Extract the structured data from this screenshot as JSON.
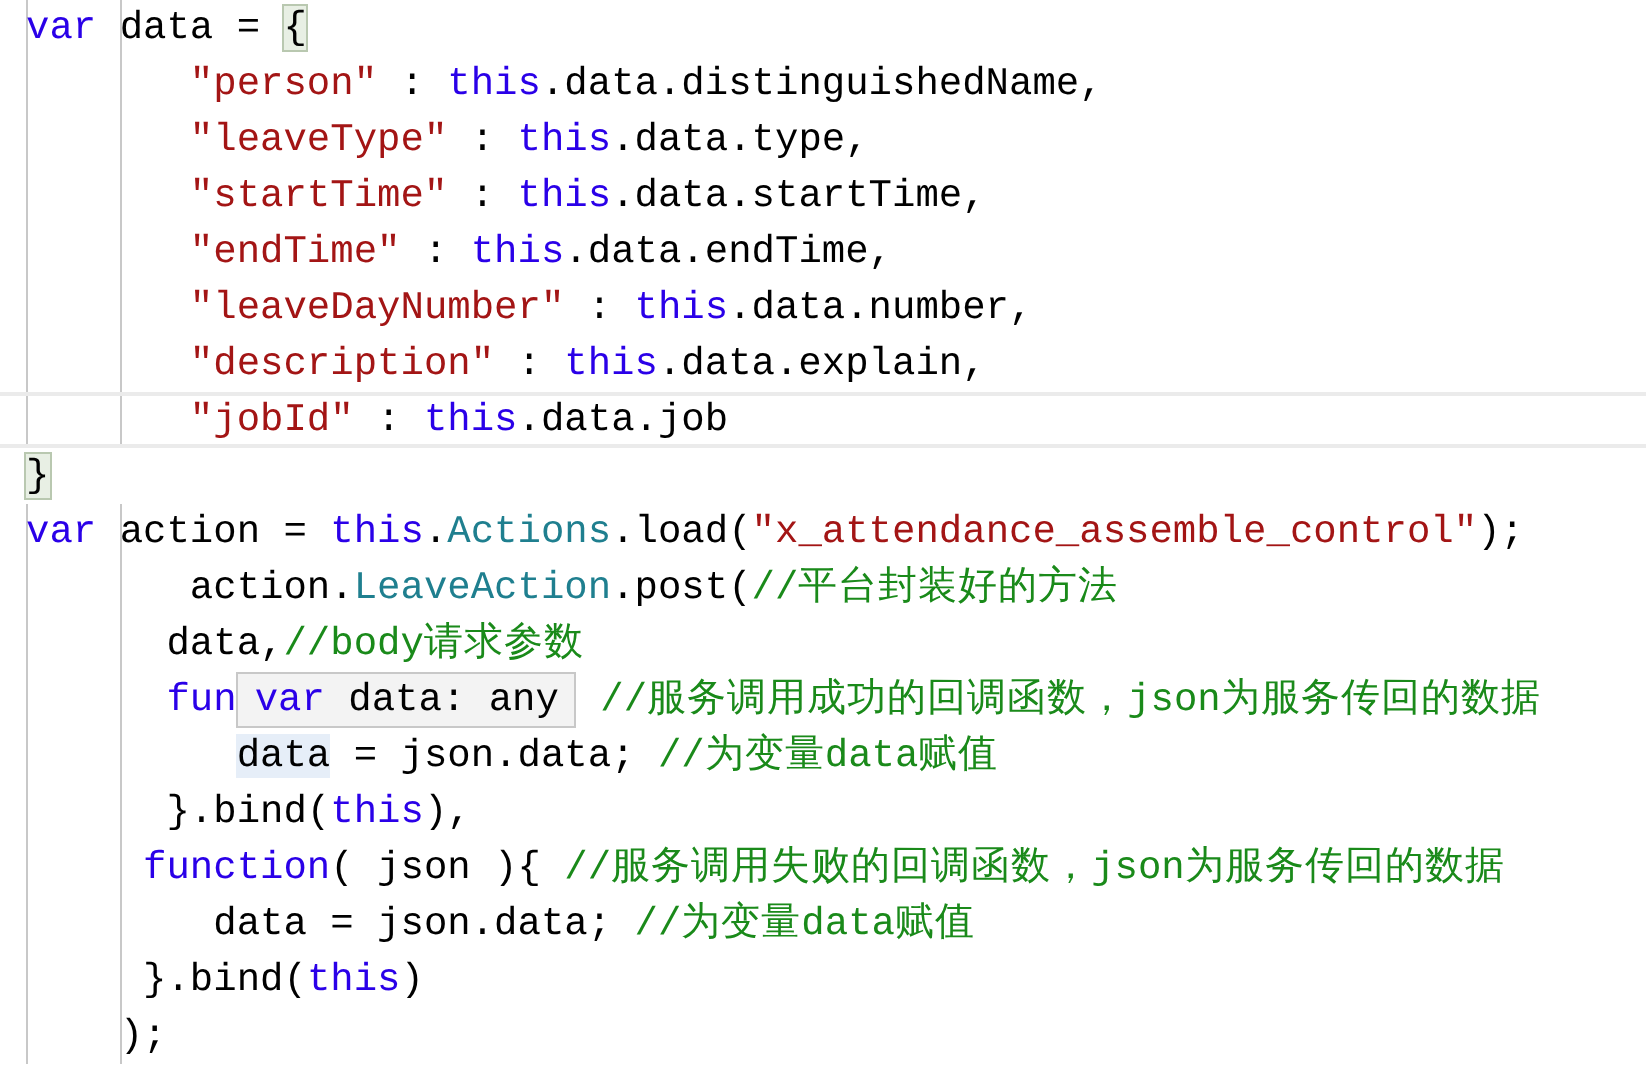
{
  "editor": {
    "lines": [
      {
        "current": false,
        "tokens": [
          {
            "kind": "kw",
            "text": "var"
          },
          {
            "kind": "plain",
            "text": " data = "
          },
          {
            "kind": "plain",
            "text": "{",
            "matched": true
          }
        ]
      },
      {
        "current": false,
        "tokens": [
          {
            "kind": "str",
            "text": "       \"person\""
          },
          {
            "kind": "plain",
            "text": " : "
          },
          {
            "kind": "kw",
            "text": "this"
          },
          {
            "kind": "plain",
            "text": ".data.distinguishedName,"
          }
        ]
      },
      {
        "current": false,
        "tokens": [
          {
            "kind": "str",
            "text": "       \"leaveType\""
          },
          {
            "kind": "plain",
            "text": " : "
          },
          {
            "kind": "kw",
            "text": "this"
          },
          {
            "kind": "plain",
            "text": ".data.type,"
          }
        ]
      },
      {
        "current": false,
        "tokens": [
          {
            "kind": "str",
            "text": "       \"startTime\""
          },
          {
            "kind": "plain",
            "text": " : "
          },
          {
            "kind": "kw",
            "text": "this"
          },
          {
            "kind": "plain",
            "text": ".data.startTime,"
          }
        ]
      },
      {
        "current": false,
        "tokens": [
          {
            "kind": "str",
            "text": "       \"endTime\""
          },
          {
            "kind": "plain",
            "text": " : "
          },
          {
            "kind": "kw",
            "text": "this"
          },
          {
            "kind": "plain",
            "text": ".data.endTime,"
          }
        ]
      },
      {
        "current": false,
        "tokens": [
          {
            "kind": "str",
            "text": "       \"leaveDayNumber\""
          },
          {
            "kind": "plain",
            "text": " : "
          },
          {
            "kind": "kw",
            "text": "this"
          },
          {
            "kind": "plain",
            "text": ".data.number,"
          }
        ]
      },
      {
        "current": false,
        "tokens": [
          {
            "kind": "str",
            "text": "       \"description\""
          },
          {
            "kind": "plain",
            "text": " : "
          },
          {
            "kind": "kw",
            "text": "this"
          },
          {
            "kind": "plain",
            "text": ".data.explain,"
          }
        ]
      },
      {
        "current": true,
        "tokens": [
          {
            "kind": "str",
            "text": "       \"jobId\""
          },
          {
            "kind": "plain",
            "text": " : "
          },
          {
            "kind": "kw",
            "text": "this"
          },
          {
            "kind": "plain",
            "text": ".data.job"
          }
        ]
      },
      {
        "current": false,
        "tokens": [
          {
            "kind": "plain",
            "text": "}",
            "matched": true
          }
        ]
      },
      {
        "current": false,
        "tokens": [
          {
            "kind": "kw",
            "text": "var"
          },
          {
            "kind": "plain",
            "text": " action = "
          },
          {
            "kind": "kw",
            "text": "this"
          },
          {
            "kind": "plain",
            "text": "."
          },
          {
            "kind": "type",
            "text": "Actions"
          },
          {
            "kind": "plain",
            "text": ".load("
          },
          {
            "kind": "str",
            "text": "\"x_attendance_assemble_control\""
          },
          {
            "kind": "plain",
            "text": ");"
          }
        ]
      },
      {
        "current": false,
        "tokens": [
          {
            "kind": "plain",
            "text": "       action."
          },
          {
            "kind": "type",
            "text": "LeaveAction"
          },
          {
            "kind": "plain",
            "text": ".post("
          },
          {
            "kind": "com",
            "text": "//平台封装好的方法"
          }
        ]
      },
      {
        "current": false,
        "tokens": [
          {
            "kind": "plain",
            "text": "      data,"
          },
          {
            "kind": "com",
            "text": "//body请求参数"
          }
        ]
      },
      {
        "current": false,
        "tokens": [
          {
            "kind": "kw",
            "text": "      fun"
          },
          {
            "kind": "tooltip",
            "tokens": [
              {
                "kind": "kw",
                "text": "var"
              },
              {
                "kind": "plain",
                "text": " data: any"
              }
            ]
          },
          {
            "kind": "com",
            "text": " //服务调用成功的回调函数，json为服务传回的数据"
          }
        ]
      },
      {
        "current": false,
        "tokens": [
          {
            "kind": "plain",
            "text": "         data",
            "highlighted": true
          },
          {
            "kind": "plain",
            "text": " = json.data; "
          },
          {
            "kind": "com",
            "text": "//为变量data赋值"
          }
        ]
      },
      {
        "current": false,
        "tokens": [
          {
            "kind": "plain",
            "text": "      }.bind("
          },
          {
            "kind": "kw",
            "text": "this"
          },
          {
            "kind": "plain",
            "text": "),"
          }
        ]
      },
      {
        "current": false,
        "tokens": [
          {
            "kind": "kw",
            "text": "     function"
          },
          {
            "kind": "plain",
            "text": "( json ){ "
          },
          {
            "kind": "com",
            "text": "//服务调用失败的回调函数，json为服务传回的数据"
          }
        ]
      },
      {
        "current": false,
        "tokens": [
          {
            "kind": "plain",
            "text": "        data = json.data; "
          },
          {
            "kind": "com",
            "text": "//为变量data赋值"
          }
        ]
      },
      {
        "current": false,
        "tokens": [
          {
            "kind": "plain",
            "text": "     }.bind("
          },
          {
            "kind": "kw",
            "text": "this"
          },
          {
            "kind": "plain",
            "text": ")"
          }
        ]
      },
      {
        "current": false,
        "tokens": [
          {
            "kind": "plain",
            "text": "    );"
          }
        ]
      }
    ]
  }
}
